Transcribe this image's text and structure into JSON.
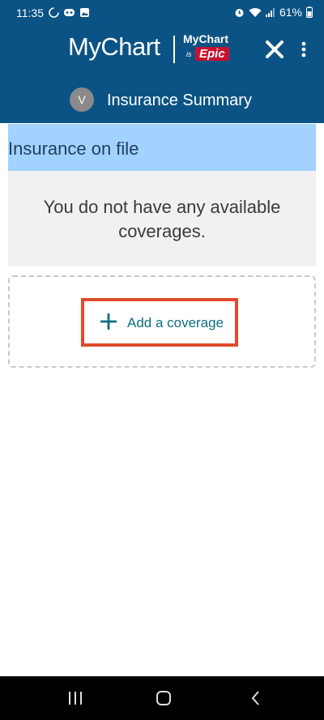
{
  "status_bar": {
    "time": "11:35",
    "battery": "61%",
    "left_icons": [
      "sync-icon",
      "game-icon",
      "image-icon"
    ],
    "right_icons": [
      "alarm-icon",
      "wifi-icon",
      "signal-icon",
      "battery-icon"
    ]
  },
  "header": {
    "brand": "MyChart",
    "brand2_top": "MyChart",
    "brand2_is": "is",
    "brand2_epic": "Epic",
    "avatar_initial": "V",
    "page_title": "Insurance Summary",
    "colors": {
      "header_bg": "#0b5384",
      "epic_red": "#c8102e"
    }
  },
  "main": {
    "section_title": "Insurance on file",
    "empty_message": "You do not have any available coverages.",
    "add_button_label": "Add a coverage",
    "colors": {
      "section_bg": "#a2d2ff",
      "add_text": "#0b6f7e",
      "highlight": "#e04a2a"
    }
  },
  "nav_bar": {
    "items": [
      "recents-icon",
      "home-icon",
      "back-icon"
    ]
  }
}
